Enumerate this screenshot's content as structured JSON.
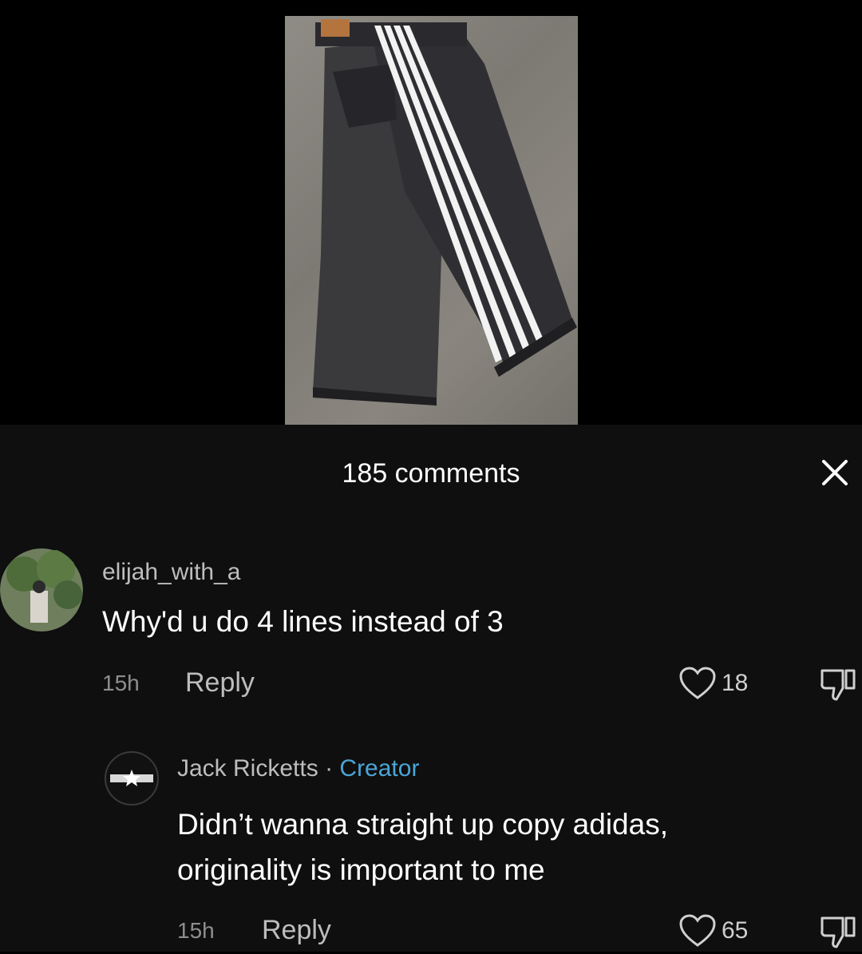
{
  "media": {
    "photo_icon": "photo-of-jeans-with-four-white-stripes"
  },
  "comments_sheet": {
    "title": "185 comments",
    "close_icon": "close-icon"
  },
  "comments": [
    {
      "username": "elijah_with_a",
      "text": "Why'd u do 4 lines instead of 3",
      "time": "15h",
      "reply_label": "Reply",
      "likes": "18"
    },
    {
      "username": "Jack Ricketts",
      "separator": "·",
      "badge": "Creator",
      "text_line1": "Didn’t wanna straight up copy adidas,",
      "text_line2": "originality is important to me",
      "time": "15h",
      "reply_label": "Reply",
      "likes": "65"
    }
  ],
  "colors": {
    "creator_badge": "#4ba6d6",
    "sheet_background": "#0f0f0f"
  }
}
